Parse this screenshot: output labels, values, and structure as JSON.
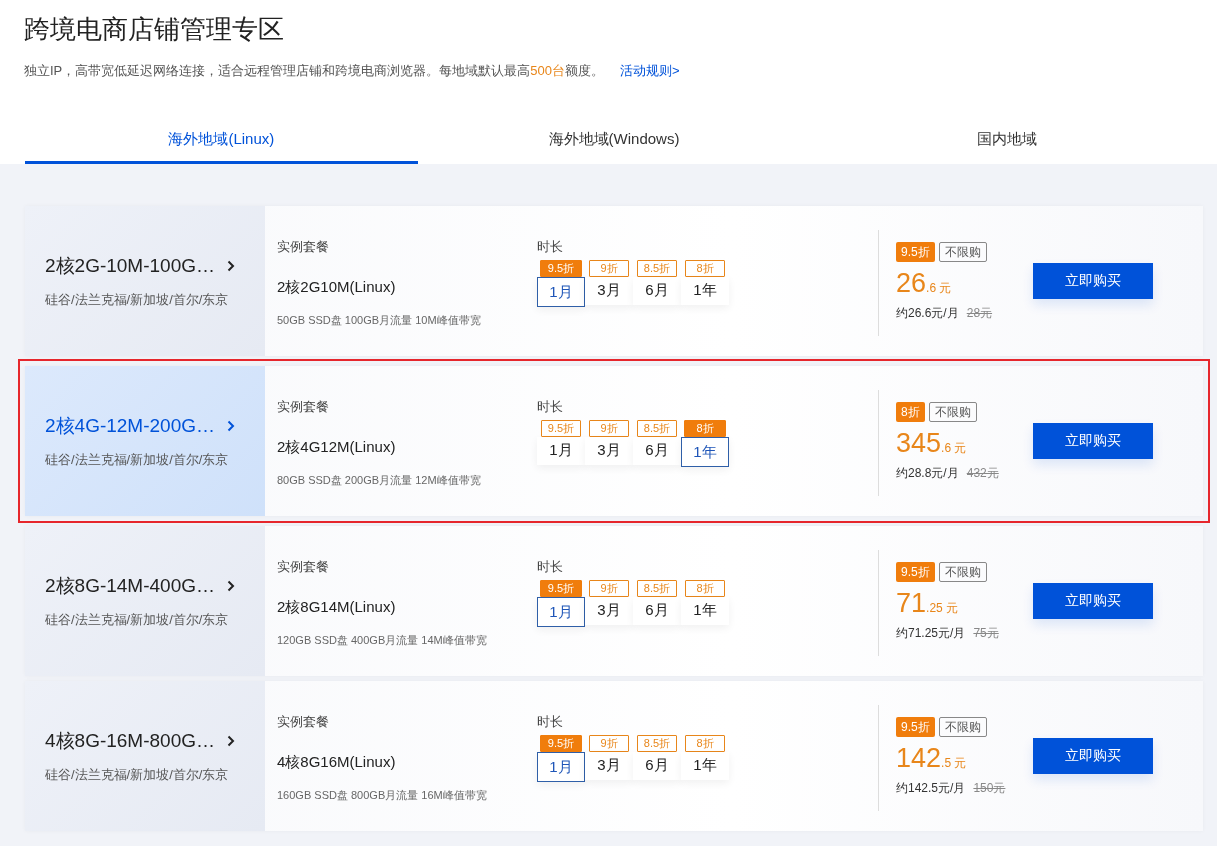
{
  "header": {
    "title": "跨境电商店铺管理专区",
    "description_before": "独立IP，高带宽低延迟网络连接，适合远程管理店铺和跨境电商浏览器。每地域默认最高",
    "description_highlight": "500台",
    "description_after": "额度。",
    "link": "活动规则>"
  },
  "tabs": [
    {
      "label": "海外地域(Linux)",
      "selected": true
    },
    {
      "label": "海外地域(Windows)",
      "selected": false
    },
    {
      "label": "国内地域",
      "selected": false
    }
  ],
  "products": [
    {
      "name": "2核2G-10M-100G…",
      "regions": "硅谷/法兰克福/新加坡/首尔/东京",
      "highlighted": false,
      "plan_label": "实例套餐",
      "plan": "2核2G10M(Linux)",
      "specs": "50GB SSD盘 100GB月流量 10M峰值带宽",
      "duration_label": "时长",
      "durations": [
        {
          "label": "1月",
          "discount": "9.5折",
          "selected": true
        },
        {
          "label": "3月",
          "discount": "9折",
          "selected": false
        },
        {
          "label": "6月",
          "discount": "8.5折",
          "selected": false
        },
        {
          "label": "1年",
          "discount": "8折",
          "selected": false
        }
      ],
      "discount_badge": "9.5折",
      "limit_tag": "不限购",
      "price_int": "26",
      "price_dec": ".6",
      "currency": "元",
      "monthly": "约26.6元/月",
      "original_price": "28元",
      "buy": "立即购买"
    },
    {
      "name": "2核4G-12M-200G…",
      "regions": "硅谷/法兰克福/新加坡/首尔/东京",
      "highlighted": true,
      "plan_label": "实例套餐",
      "plan": "2核4G12M(Linux)",
      "specs": "80GB SSD盘 200GB月流量 12M峰值带宽",
      "duration_label": "时长",
      "durations": [
        {
          "label": "1月",
          "discount": "9.5折",
          "selected": false
        },
        {
          "label": "3月",
          "discount": "9折",
          "selected": false
        },
        {
          "label": "6月",
          "discount": "8.5折",
          "selected": false
        },
        {
          "label": "1年",
          "discount": "8折",
          "selected": true
        }
      ],
      "discount_badge": "8折",
      "limit_tag": "不限购",
      "price_int": "345",
      "price_dec": ".6",
      "currency": "元",
      "monthly": "约28.8元/月",
      "original_price": "432元",
      "buy": "立即购买"
    },
    {
      "name": "2核8G-14M-400G…",
      "regions": "硅谷/法兰克福/新加坡/首尔/东京",
      "highlighted": false,
      "plan_label": "实例套餐",
      "plan": "2核8G14M(Linux)",
      "specs": "120GB SSD盘 400GB月流量 14M峰值带宽",
      "duration_label": "时长",
      "durations": [
        {
          "label": "1月",
          "discount": "9.5折",
          "selected": true
        },
        {
          "label": "3月",
          "discount": "9折",
          "selected": false
        },
        {
          "label": "6月",
          "discount": "8.5折",
          "selected": false
        },
        {
          "label": "1年",
          "discount": "8折",
          "selected": false
        }
      ],
      "discount_badge": "9.5折",
      "limit_tag": "不限购",
      "price_int": "71",
      "price_dec": ".25",
      "currency": "元",
      "monthly": "约71.25元/月",
      "original_price": "75元",
      "buy": "立即购买"
    },
    {
      "name": "4核8G-16M-800G…",
      "regions": "硅谷/法兰克福/新加坡/首尔/东京",
      "highlighted": false,
      "plan_label": "实例套餐",
      "plan": "4核8G16M(Linux)",
      "specs": "160GB SSD盘 800GB月流量 16M峰值带宽",
      "duration_label": "时长",
      "durations": [
        {
          "label": "1月",
          "discount": "9.5折",
          "selected": true
        },
        {
          "label": "3月",
          "discount": "9折",
          "selected": false
        },
        {
          "label": "6月",
          "discount": "8.5折",
          "selected": false
        },
        {
          "label": "1年",
          "discount": "8折",
          "selected": false
        }
      ],
      "discount_badge": "9.5折",
      "limit_tag": "不限购",
      "price_int": "142",
      "price_dec": ".5",
      "currency": "元",
      "monthly": "约142.5元/月",
      "original_price": "150元",
      "buy": "立即购买"
    }
  ]
}
